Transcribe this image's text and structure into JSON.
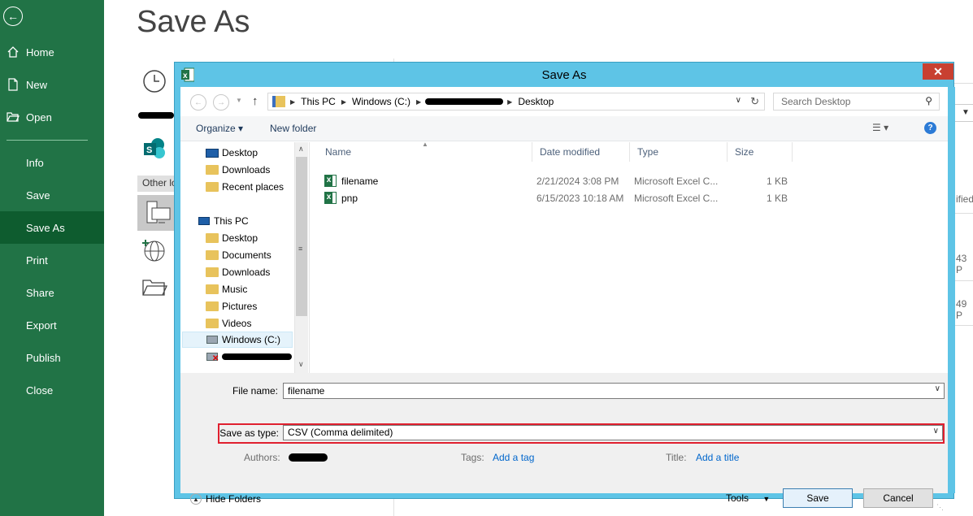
{
  "backstage": {
    "title": "Save As",
    "nav": [
      {
        "label": "Home",
        "icon": "home-icon"
      },
      {
        "label": "New",
        "icon": "new-doc-icon"
      },
      {
        "label": "Open",
        "icon": "open-folder-icon"
      },
      {
        "label": "Info"
      },
      {
        "label": "Save"
      },
      {
        "label": "Save As",
        "selected": true
      },
      {
        "label": "Print"
      },
      {
        "label": "Share"
      },
      {
        "label": "Export"
      },
      {
        "label": "Publish"
      },
      {
        "label": "Close"
      }
    ],
    "other_locations_label": "Other lo",
    "right_peek": [
      "ified",
      "43 P",
      "49 P"
    ]
  },
  "dialog": {
    "title": "Save As",
    "breadcrumb": [
      "This PC",
      "Windows (C:)",
      "Desktop"
    ],
    "search_placeholder": "Search Desktop",
    "commands": {
      "organize": "Organize ▾",
      "new_folder": "New folder"
    },
    "tree": [
      {
        "label": "Desktop",
        "icon": "desktop-icon",
        "indent": 1
      },
      {
        "label": "Downloads",
        "icon": "folder-icon",
        "indent": 1
      },
      {
        "label": "Recent places",
        "icon": "folder-icon",
        "indent": 1
      },
      {
        "label": "This PC",
        "icon": "computer-icon",
        "indent": 0
      },
      {
        "label": "Desktop",
        "icon": "folder-icon",
        "indent": 1
      },
      {
        "label": "Documents",
        "icon": "folder-icon",
        "indent": 1
      },
      {
        "label": "Downloads",
        "icon": "folder-icon",
        "indent": 1
      },
      {
        "label": "Music",
        "icon": "folder-icon",
        "indent": 1
      },
      {
        "label": "Pictures",
        "icon": "folder-icon",
        "indent": 1
      },
      {
        "label": "Videos",
        "icon": "folder-icon",
        "indent": 1
      },
      {
        "label": "Windows (C:)",
        "icon": "drive-icon",
        "indent": 1,
        "selected": true
      }
    ],
    "columns": {
      "name": "Name",
      "date": "Date modified",
      "type": "Type",
      "size": "Size"
    },
    "files": [
      {
        "name": "filename",
        "date": "2/21/2024 3:08 PM",
        "type": "Microsoft Excel C...",
        "size": "1 KB"
      },
      {
        "name": "pnp",
        "date": "6/15/2023 10:18 AM",
        "type": "Microsoft Excel C...",
        "size": "1 KB"
      }
    ],
    "form": {
      "file_name_label": "File name:",
      "file_name_value": "filename",
      "save_type_label": "Save as type:",
      "save_type_value": "CSV (Comma delimited)",
      "authors_label": "Authors:",
      "tags_label": "Tags:",
      "tags_value": "Add a tag",
      "title_label": "Title:",
      "title_value": "Add a title"
    },
    "footer": {
      "hide_folders": "Hide Folders",
      "tools": "Tools",
      "save": "Save",
      "cancel": "Cancel"
    },
    "colors": {
      "frame": "#5ec4e6",
      "close": "#c84031",
      "highlight": "#e0202f",
      "excel_green": "#217346"
    }
  }
}
